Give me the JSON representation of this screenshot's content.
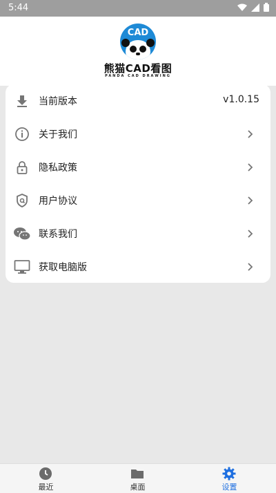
{
  "status_bar": {
    "time": "5:44"
  },
  "logo": {
    "circle_text": "CAD",
    "title": "熊猫CAD看图",
    "subtitle": "PANDA CAD DRAWING"
  },
  "menu": {
    "items": [
      {
        "label": "当前版本",
        "value": "v1.0.15",
        "icon": "download-icon"
      },
      {
        "label": "关于我们",
        "icon": "info-icon"
      },
      {
        "label": "隐私政策",
        "icon": "lock-icon"
      },
      {
        "label": "用户协议",
        "icon": "shield-icon"
      },
      {
        "label": "联系我们",
        "icon": "wechat-icon"
      },
      {
        "label": "获取电脑版",
        "icon": "monitor-icon"
      }
    ]
  },
  "bottom_nav": {
    "tabs": [
      {
        "label": "最近",
        "icon": "clock-icon"
      },
      {
        "label": "桌面",
        "icon": "folder-icon"
      },
      {
        "label": "设置",
        "icon": "gear-icon",
        "active": true
      }
    ]
  },
  "colors": {
    "accent": "#1e6fe0",
    "brand": "#1e8ad6",
    "background": "#e8e8e8",
    "status_bar": "#9e9e9e"
  }
}
